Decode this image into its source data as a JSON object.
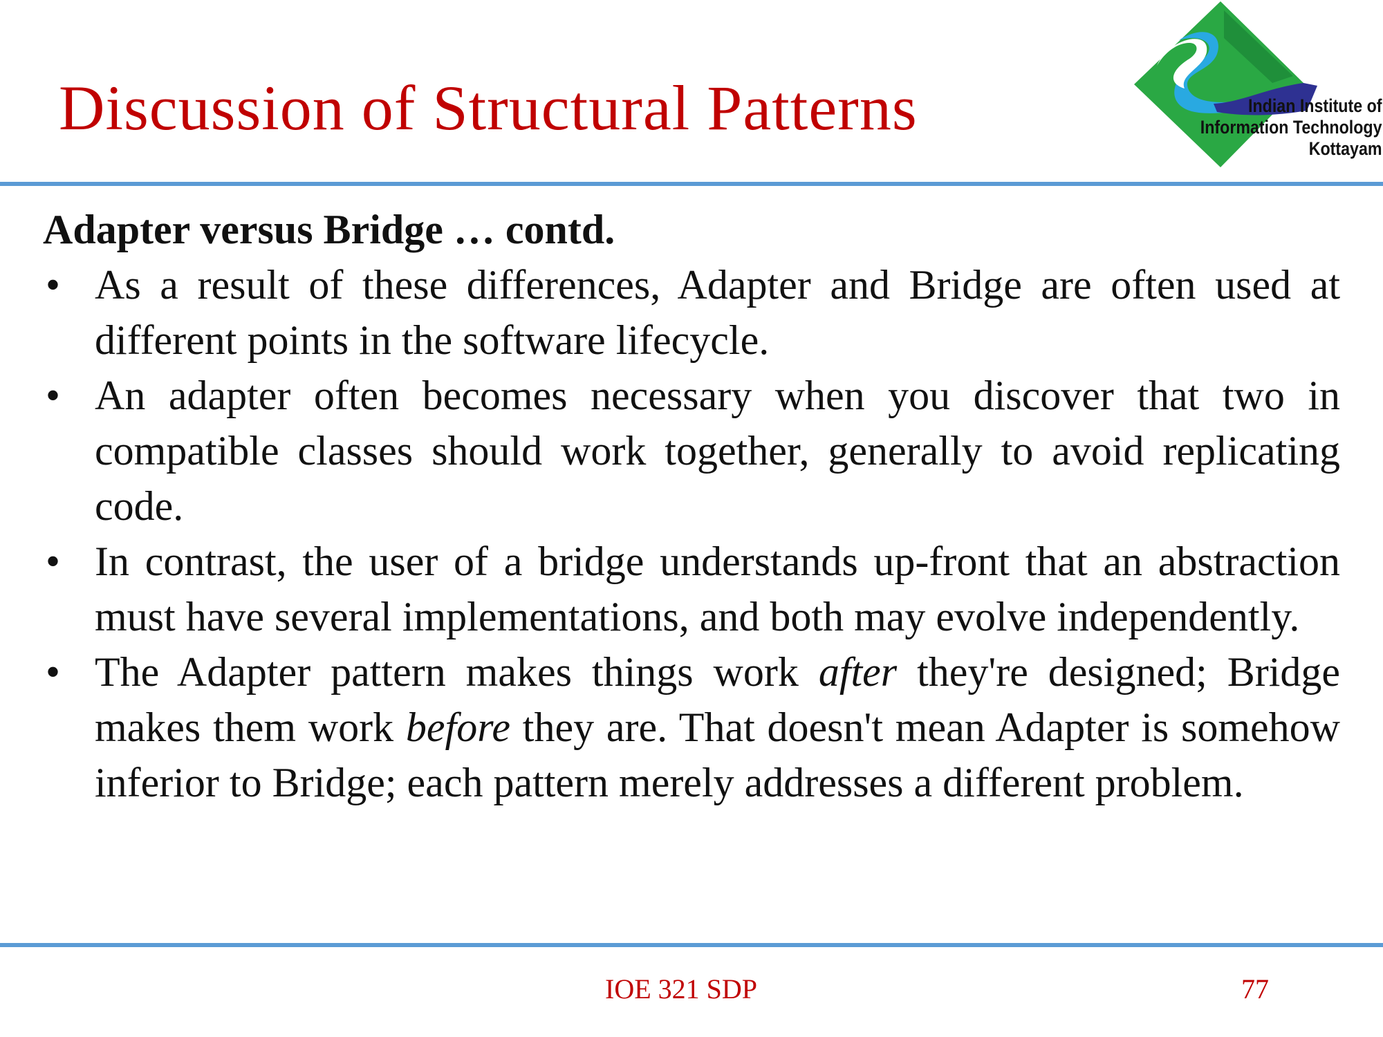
{
  "slide": {
    "title": "Discussion of Structural Patterns",
    "subtitle": "Adapter versus Bridge … contd.",
    "bullets": [
      [
        {
          "t": "As a result of  these differences, Adapter and Bridge are often used at different points in the software lifecycle."
        }
      ],
      [
        {
          "t": "An adapter often becomes necessary when you discover that two in compatible classes should work together, generally to avoid replicating code."
        }
      ],
      [
        {
          "t": "In contrast, the user of  a bridge understands up-front that an abstraction must have several implementations, and both may evolve independently."
        }
      ],
      [
        {
          "t": "The Adapter pattern makes things work "
        },
        {
          "t": "after",
          "i": true
        },
        {
          "t": " they're designed; Bridge makes them work "
        },
        {
          "t": "before",
          "i": true
        },
        {
          "t": " they are. That doesn't mean Adapter is somehow inferior to Bridge; each pattern merely addresses a different problem."
        }
      ]
    ],
    "bullet_glyph": "•"
  },
  "logo": {
    "line1": "Indian Institute of",
    "line2": "Information Technology",
    "line3": "Kottayam",
    "icon": "iiit-kottayam-logo-icon"
  },
  "footer": {
    "course": "IOE 321 SDP",
    "page": "77"
  },
  "colors": {
    "title": "#c00000",
    "rule": "#5b9bd5",
    "text": "#111111",
    "logo_green": "#2aa844",
    "logo_dark_green": "#1f8f3a",
    "logo_light_blue": "#29a9e1",
    "logo_navy": "#2e3192"
  }
}
